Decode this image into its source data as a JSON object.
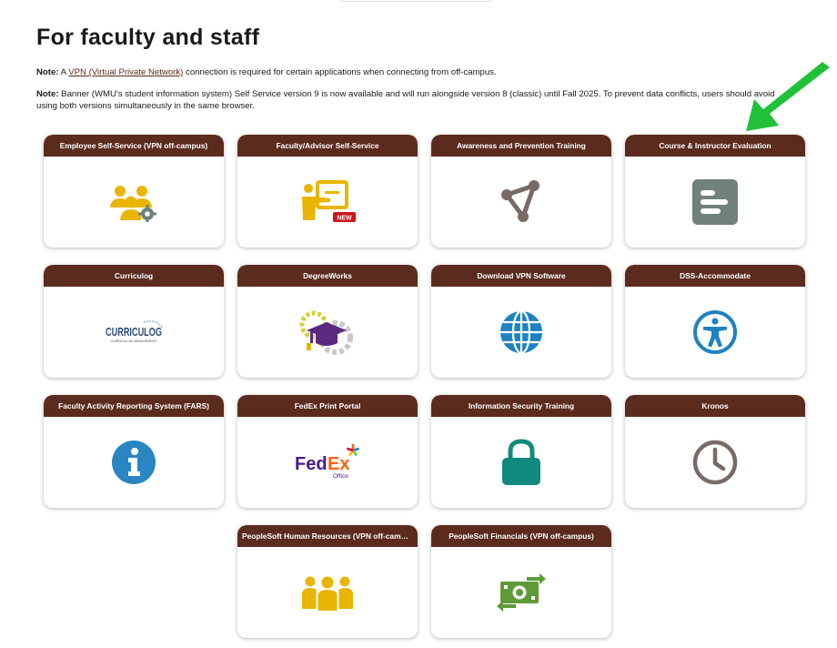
{
  "page": {
    "title": "For faculty and staff"
  },
  "notes": {
    "note1": {
      "label": "Note:",
      "prefix": " A ",
      "link": "VPN (Virtual Private Network)",
      "suffix": " connection is required for certain applications when connecting from off-campus."
    },
    "note2": {
      "label": "Note:",
      "text": " Banner (WMU's student information system) Self Service version 9 is now available and will run alongside version 8 (classic) until Fall 2025. To prevent data conflicts, users should avoid using both versions simultaneously in the same browser."
    }
  },
  "colors": {
    "header_bg": "#5b2c1e",
    "gold": "#e8b600",
    "slate": "#71817d",
    "blue": "#1f82c1",
    "teal": "#118a7e",
    "gray_icon": "#786b65",
    "new_badge": "#d0121b",
    "arrow": "#22c13a"
  },
  "tiles": [
    {
      "label": "Employee Self-Service (VPN off-campus)",
      "icon": "users-gear-icon"
    },
    {
      "label": "Faculty/Advisor Self-Service",
      "icon": "presenter-board-icon",
      "badge": "NEW"
    },
    {
      "label": "Awareness and Prevention Training",
      "icon": "network-nodes-icon"
    },
    {
      "label": "Course & Instructor Evaluation",
      "icon": "evaluation-lines-icon"
    },
    {
      "label": "Curriculog",
      "icon": "curriculog-logo",
      "logo_text": "CURRICULOG",
      "logo_sub": "CURRICULUM MANAGEMENT"
    },
    {
      "label": "DegreeWorks",
      "icon": "graduation-gears-icon"
    },
    {
      "label": "Download VPN Software",
      "icon": "globe-icon"
    },
    {
      "label": "DSS-Accommodate",
      "icon": "accessibility-icon"
    },
    {
      "label": "Faculty Activity Reporting System (FARS)",
      "icon": "info-icon"
    },
    {
      "label": "FedEx Print Portal",
      "icon": "fedex-logo",
      "logo_fed": "Fed",
      "logo_ex": "Ex",
      "logo_sub": "Office"
    },
    {
      "label": "Information Security Training",
      "icon": "lock-icon"
    },
    {
      "label": "Kronos",
      "icon": "clock-icon"
    },
    {
      "label": "PeopleSoft Human Resources (VPN off-campus)",
      "icon": "people-group-icon"
    },
    {
      "label": "PeopleSoft Financials (VPN off-campus)",
      "icon": "money-exchange-icon"
    }
  ]
}
